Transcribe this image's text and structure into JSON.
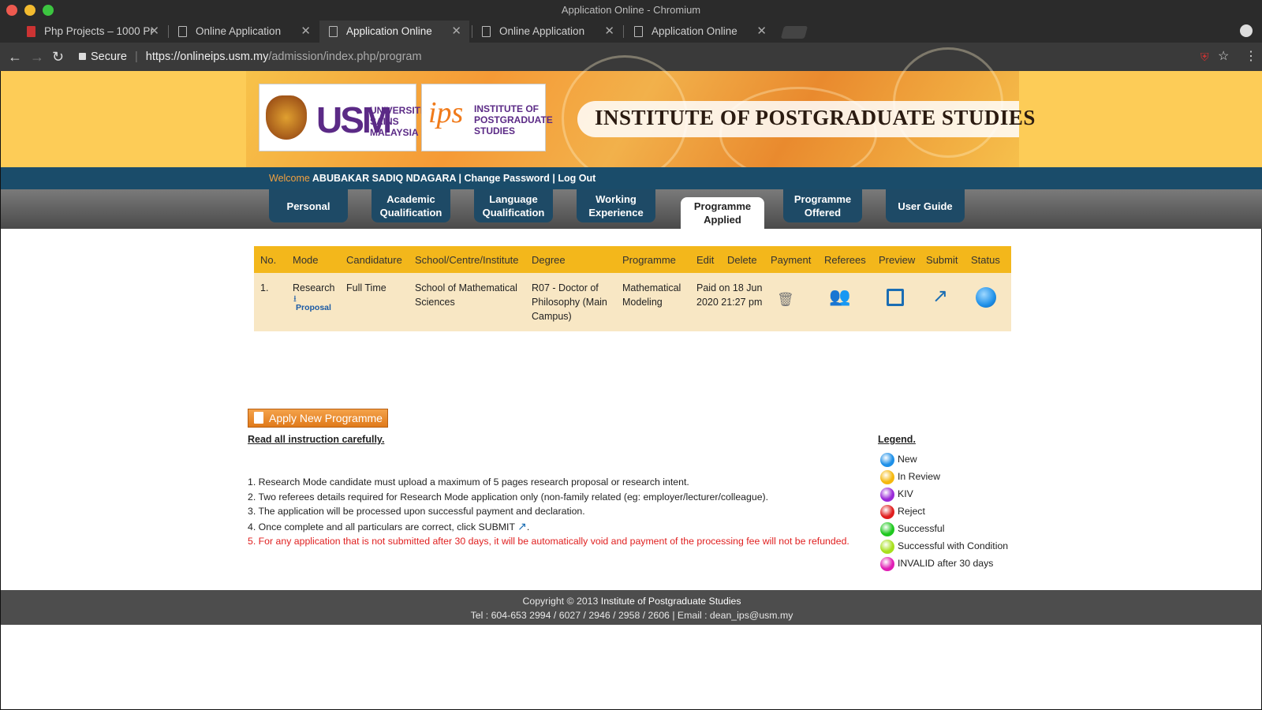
{
  "window": {
    "title": "Application Online - Chromium"
  },
  "tabs": [
    {
      "label": "Php Projects – 1000 Pr"
    },
    {
      "label": "Online Application"
    },
    {
      "label": "Application Online"
    },
    {
      "label": "Online Application"
    },
    {
      "label": "Application Online"
    }
  ],
  "address": {
    "secure_label": "Secure",
    "url_host": "https://onlineips.usm.my",
    "url_path": "/admission/index.php/program"
  },
  "banner": {
    "usm_logo": "USM",
    "usm_sub": "UNIVERSITI SAINS MALAYSIA",
    "ips_logo": "ips",
    "ips_sub": "INSTITUTE OF POSTGRADUATE STUDIES",
    "title": "INSTITUTE OF POSTGRADUATE STUDIES"
  },
  "welcome": {
    "label": "Welcome",
    "name": "ABUBAKAR SADIQ NDAGARA",
    "sep": "|",
    "change_password": "Change Password",
    "logout": "Log Out"
  },
  "menu": {
    "personal": "Personal",
    "academic": "Academic Qualification",
    "language": "Language Qualification",
    "working": "Working Experience",
    "applied": "Programme Applied",
    "offered": "Programme Offered",
    "guide": "User Guide"
  },
  "table": {
    "headers": [
      "No.",
      "Mode",
      "Candidature",
      "School/Centre/Institute",
      "Degree",
      "Programme",
      "Edit",
      "Delete",
      "Payment",
      "Referees",
      "Preview",
      "Submit",
      "Status"
    ],
    "row": {
      "no": "1.",
      "mode": "Research",
      "proposal": "Proposal",
      "candidature": "Full Time",
      "school": "School of Mathematical Sciences",
      "degree": "R07 - Doctor of Philosophy (Main Campus)",
      "programme": "Mathematical Modeling",
      "payment": "Paid on 18 Jun 2020 21:27 pm",
      "status_color": "#1e90e8"
    }
  },
  "apply_button": "Apply New Programme",
  "read_all": "Read all instruction carefully.",
  "instructions": {
    "i1": "1. Research Mode candidate must upload a maximum of 5 pages research proposal or research intent.",
    "i2": "2. Two referees details required for Research Mode application only (non-family related (eg: employer/lecturer/colleague).",
    "i3": "3. The application will be processed upon successful payment and declaration.",
    "i4": "4. Once complete and all particulars are correct, click SUBMIT",
    "i4_end": ".",
    "i5": "5. For any application that is not submitted after 30 days, it will be automatically void and payment of the processing fee will not be refunded."
  },
  "legend": {
    "title": "Legend.",
    "items": [
      {
        "label": "New",
        "color": "#1e90e8"
      },
      {
        "label": "In Review",
        "color": "#f5b80f"
      },
      {
        "label": "KIV",
        "color": "#9a2ad8"
      },
      {
        "label": "Reject",
        "color": "#e01e1e"
      },
      {
        "label": "Successful",
        "color": "#1ec81e"
      },
      {
        "label": "Successful with Condition",
        "color": "#a8e01e"
      },
      {
        "label": "INVALID after 30 days",
        "color": "#e01eb4"
      }
    ]
  },
  "footer": {
    "copyright": "Copyright © 2013",
    "org": "Institute of Postgraduate Studies",
    "contact": "Tel : 604-653 2994 / 6027 / 2946 / 2958 / 2606 | Email : dean_ips@usm.my"
  }
}
